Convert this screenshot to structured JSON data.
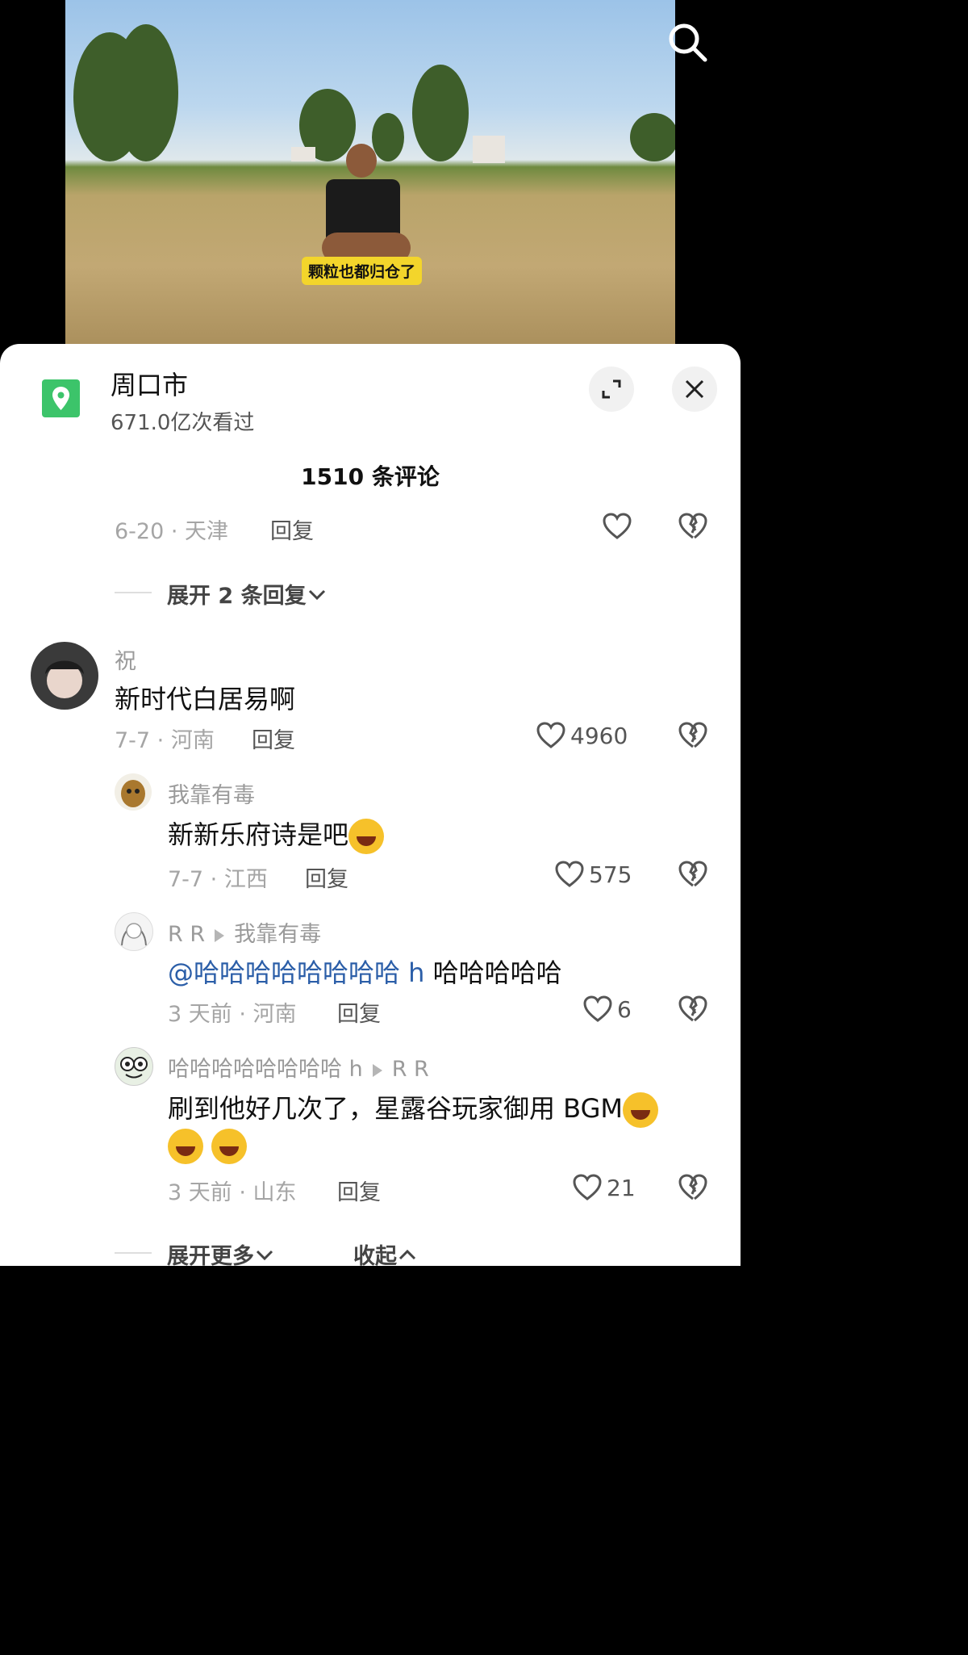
{
  "video": {
    "caption": "颗粒也都归仓了"
  },
  "location": {
    "title": "周口市",
    "views": "671.0亿次看过"
  },
  "comments_header": "1510 条评论",
  "prev_comment": {
    "meta": "6-20 · 天津",
    "reply": "回复"
  },
  "expand_replies": "展开 2 条回复",
  "comment1": {
    "name": "祝",
    "text": "新时代白居易啊",
    "meta": "7-7 · 河南",
    "reply": "回复",
    "likes": "4960"
  },
  "reply1": {
    "name": "我靠有毒",
    "text": "新新乐府诗是吧",
    "meta": "7-7 · 江西",
    "reply": "回复",
    "likes": "575"
  },
  "reply2": {
    "name": "R R",
    "to": "我靠有毒",
    "mention": "@哈哈哈哈哈哈哈哈 h",
    "text": " 哈哈哈哈哈",
    "meta": "3 天前 · 河南",
    "reply": "回复",
    "likes": "6"
  },
  "reply3": {
    "name": "哈哈哈哈哈哈哈哈 h",
    "to": "R R",
    "text": "刷到他好几次了，星露谷玩家御用 BGM",
    "meta": "3 天前 · 山东",
    "reply": "回复",
    "likes": "21"
  },
  "footer": {
    "more": "展开更多",
    "collapse": "收起"
  },
  "colors": {
    "accent_green": "#3cc46a",
    "mention_blue": "#2b5ea8",
    "caption_yellow": "#f3d52b"
  },
  "icons": [
    "search-icon",
    "location-icon",
    "expand-icon",
    "close-icon",
    "heart-icon",
    "broken-heart-icon",
    "chevron-down-icon",
    "chevron-up-icon",
    "laughing-emoji-icon"
  ]
}
